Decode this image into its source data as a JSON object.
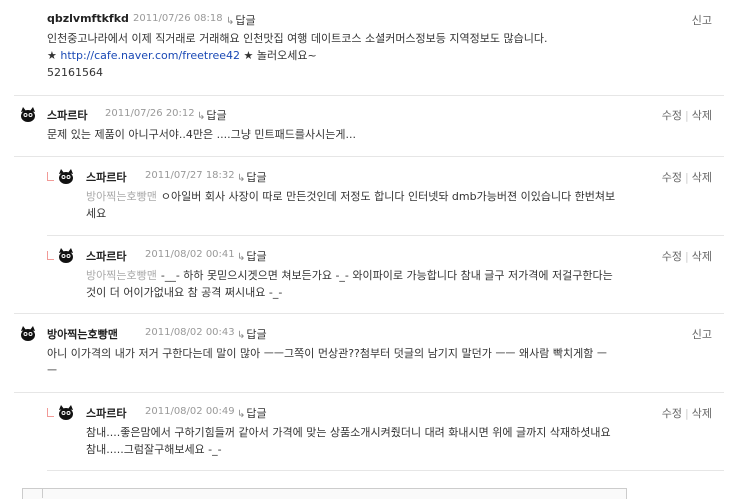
{
  "comments": [
    {
      "nick": "qbzlvmftkfkd",
      "date": "2011/07/26 08:18",
      "reply_label": "답글",
      "report_label": "신고",
      "line1": "인천중고나라에서 이제 직거래로 거래해요 인천맛집 여행 데이트코스 소셜커머스정보등 지역정보도 많습니다.",
      "star1": "★",
      "link": "http://cafe.naver.com/freetree42",
      "star2": "★",
      "link_suffix": "놀러오세요~",
      "line3": "52161564"
    },
    {
      "nick": "스파르타",
      "date": "2011/07/26 20:12",
      "reply_label": "답글",
      "edit_label": "수정",
      "delete_label": "삭제",
      "text": "문제 있는 제품이 아니구서야..4만은 ....그냥 민트패드를사시는게..."
    },
    {
      "nick": "스파르타",
      "date": "2011/07/27 18:32",
      "reply_label": "답글",
      "edit_label": "수정",
      "delete_label": "삭제",
      "addressee": "방아찍는호빵맨",
      "text1": "ㅇ아일버 회사 사장이 따로 만든것인데 저정도 합니다 인터넷돠 dmb가능버젼 이있습니다 한번쳐보",
      "text2": "세요"
    },
    {
      "nick": "스파르타",
      "date": "2011/08/02 00:41",
      "reply_label": "답글",
      "edit_label": "수정",
      "delete_label": "삭제",
      "addressee": "방아찍는호빵맨",
      "text1": "-__- 하하 못믿으시겟으면 쳐보든가요 -_- 와이파이로 가능합니다 참내 글구 저가격에 저걸구한다는",
      "text2": "것이 더 어이가없내요 참 공격 쩌시내요 -_-"
    },
    {
      "nick": "방아찍는호빵맨",
      "date": "2011/08/02 00:43",
      "reply_label": "답글",
      "report_label": "신고",
      "text1": "아니 이가격의 내가 저거 구한다는데 말이 많아 ㅡㅡ그쪽이 먼상관??첨부터 덧글의 남기지 말던가 ㅡㅡ 왜사람 빡치게함 ㅡ",
      "text2": "ㅡ"
    },
    {
      "nick": "스파르타",
      "date": "2011/08/02 00:49",
      "reply_label": "답글",
      "edit_label": "수정",
      "delete_label": "삭제",
      "text1": "참내....좋은맘에서 구하기힘들꺼 같아서 가격에 맞는 상품소개시켜줬더니 대려 화내시면 위에 글까지 삭재하셧내요",
      "text2": "참내.....그럼잘구해보세요 -_-"
    }
  ],
  "colors": {
    "link": "#1a49b5",
    "reply_mark": "#f19a97",
    "date": "#999999",
    "addressee": "#aaaaaa"
  }
}
